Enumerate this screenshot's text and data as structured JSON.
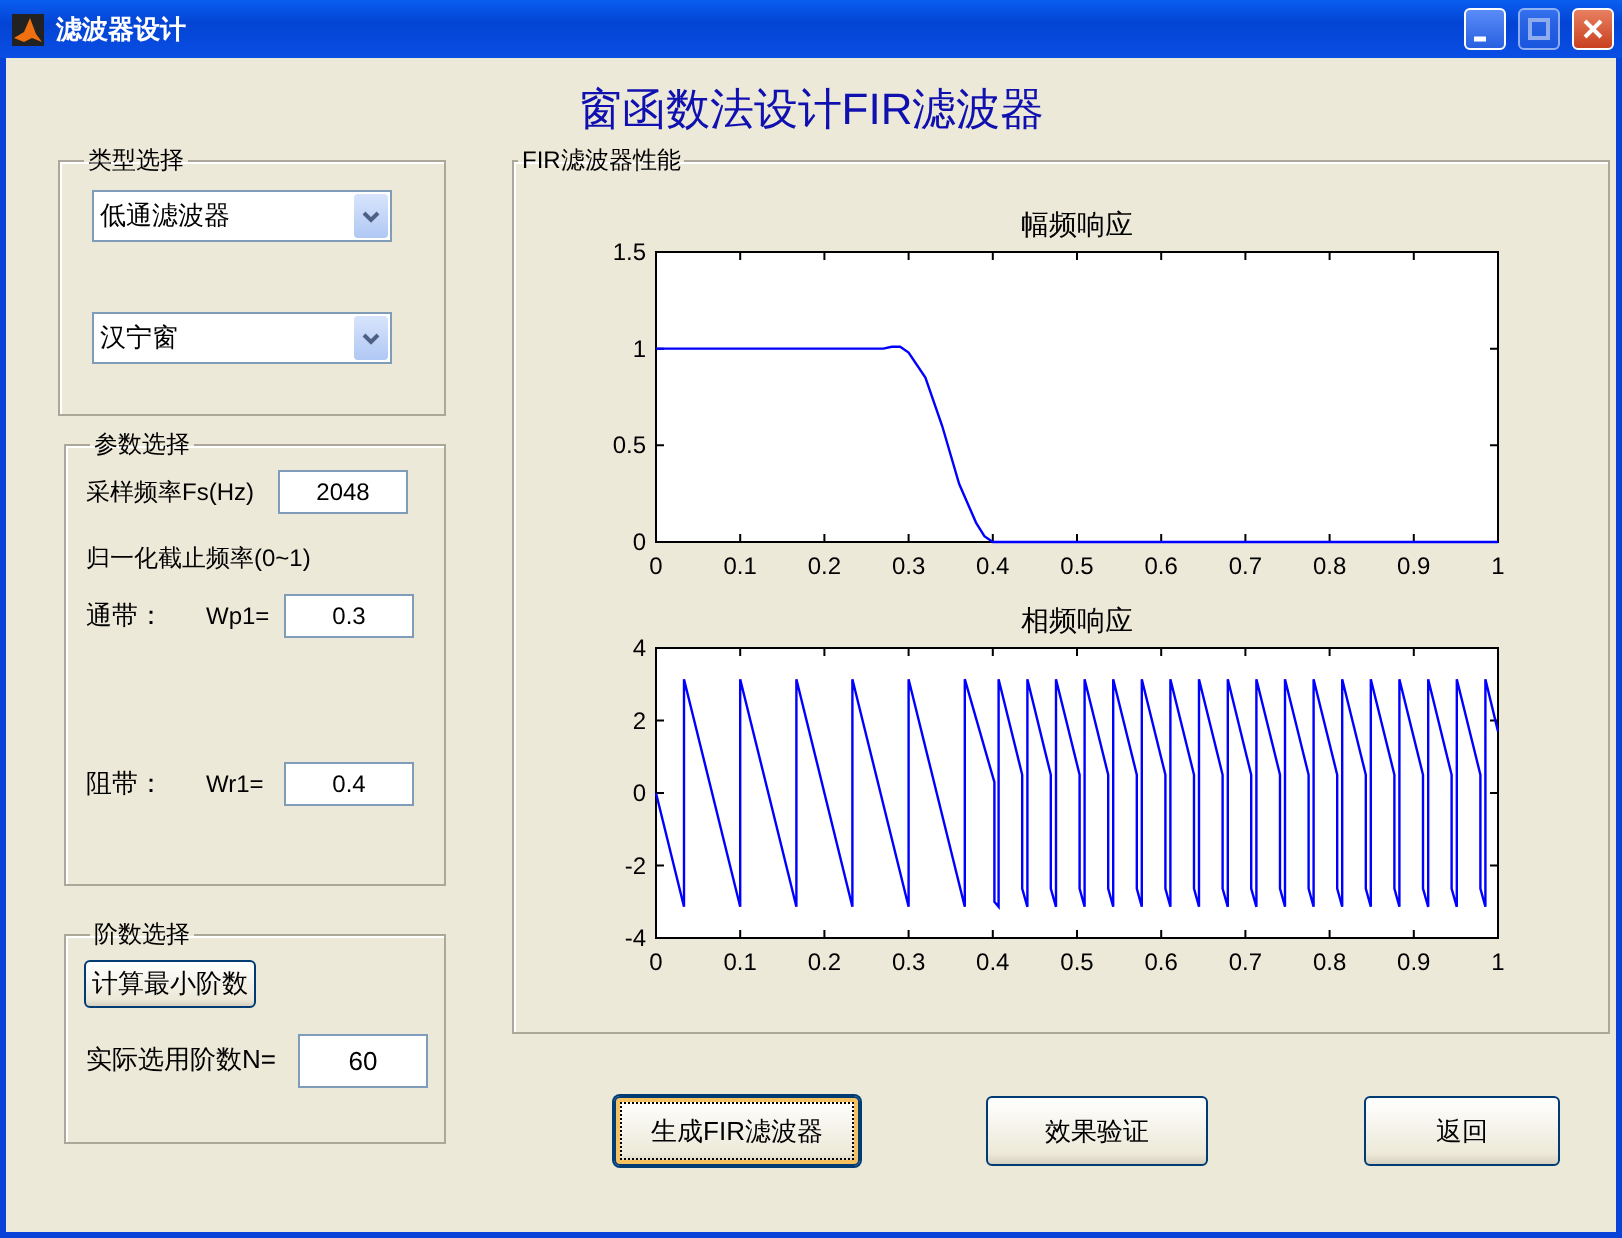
{
  "window": {
    "title": "滤波器设计",
    "controls": [
      {
        "kind": "minimize",
        "disabled": false
      },
      {
        "kind": "maximize",
        "disabled": true
      },
      {
        "kind": "close",
        "disabled": false
      }
    ]
  },
  "heading": "窗函数法设计FIR滤波器",
  "type_panel": {
    "legend": "类型选择",
    "dropdowns": [
      {
        "value": "低通滤波器"
      },
      {
        "value": "汉宁窗"
      }
    ]
  },
  "param_panel": {
    "legend": "参数选择",
    "fs_label": "采样频率Fs(Hz)",
    "fs_value": "2048",
    "cutoff_label": "归一化截止频率(0~1)",
    "bands": [
      {
        "band_label": "通带：",
        "name_label": "Wp1=",
        "value": "0.3"
      },
      {
        "band_label": "阻带：",
        "name_label": "Wr1=",
        "value": "0.4"
      }
    ]
  },
  "order_panel": {
    "legend": "阶数选择",
    "button": "计算最小阶数",
    "order_label": "实际选用阶数N=",
    "order_value": "60"
  },
  "performance_panel": {
    "legend": "FIR滤波器性能",
    "charts": [
      {
        "chart_data": {
          "type": "line",
          "title": "幅频响应",
          "xlim": [
            0,
            1
          ],
          "ylim": [
            0,
            1.5
          ],
          "xticks": [
            0,
            0.1,
            0.2,
            0.3,
            0.4,
            0.5,
            0.6,
            0.7,
            0.8,
            0.9,
            1
          ],
          "yticks": [
            0,
            0.5,
            1,
            1.5
          ],
          "x": [
            0,
            0.27,
            0.28,
            0.29,
            0.3,
            0.32,
            0.34,
            0.36,
            0.38,
            0.39,
            0.4,
            1
          ],
          "series": [
            {
              "color": "#0000ff",
              "values": [
                1,
                1,
                1.01,
                1.01,
                0.98,
                0.85,
                0.6,
                0.3,
                0.1,
                0.03,
                0,
                0
              ]
            }
          ]
        }
      },
      {
        "chart_data": {
          "type": "line",
          "title": "相频响应",
          "xlim": [
            0,
            1
          ],
          "ylim": [
            -4,
            4
          ],
          "xticks": [
            0,
            0.1,
            0.2,
            0.3,
            0.4,
            0.5,
            0.6,
            0.7,
            0.8,
            0.9,
            1
          ],
          "yticks": [
            -4,
            -2,
            0,
            2,
            4
          ],
          "x": [
            0,
            0.0333,
            0.0333,
            0.1,
            0.1,
            0.1667,
            0.1667,
            0.2333,
            0.2333,
            0.3,
            0.3,
            0.3667,
            0.3667,
            0.402,
            0.402,
            0.407,
            0.407,
            0.435,
            0.435,
            0.441,
            0.441,
            0.469,
            0.469,
            0.475,
            0.475,
            0.503,
            0.503,
            0.509,
            0.509,
            0.537,
            0.537,
            0.543,
            0.543,
            0.571,
            0.571,
            0.577,
            0.577,
            0.605,
            0.605,
            0.611,
            0.611,
            0.639,
            0.639,
            0.645,
            0.645,
            0.673,
            0.673,
            0.679,
            0.679,
            0.707,
            0.707,
            0.713,
            0.713,
            0.741,
            0.741,
            0.747,
            0.747,
            0.775,
            0.775,
            0.781,
            0.781,
            0.809,
            0.809,
            0.815,
            0.815,
            0.843,
            0.843,
            0.849,
            0.849,
            0.877,
            0.877,
            0.883,
            0.883,
            0.911,
            0.911,
            0.917,
            0.917,
            0.945,
            0.945,
            0.951,
            0.951,
            0.979,
            0.979,
            0.985,
            0.985,
            1
          ],
          "series": [
            {
              "color": "#0000ff",
              "values": [
                0,
                -3.14,
                3.14,
                -3.14,
                3.14,
                -3.14,
                3.14,
                -3.14,
                3.14,
                -3.14,
                3.14,
                -3.14,
                3.14,
                0.3,
                -3.0,
                -3.14,
                3.14,
                0.5,
                -2.64,
                -3.14,
                3.14,
                0.5,
                -2.64,
                -3.14,
                3.14,
                0.5,
                -2.64,
                -3.14,
                3.14,
                0.5,
                -2.64,
                -3.14,
                3.14,
                0.5,
                -2.64,
                -3.14,
                3.14,
                0.5,
                -2.64,
                -3.14,
                3.14,
                0.5,
                -2.64,
                -3.14,
                3.14,
                0.5,
                -2.64,
                -3.14,
                3.14,
                0.5,
                -2.64,
                -3.14,
                3.14,
                0.5,
                -2.64,
                -3.14,
                3.14,
                0.5,
                -2.64,
                -3.14,
                3.14,
                0.5,
                -2.64,
                -3.14,
                3.14,
                0.5,
                -2.64,
                -3.14,
                3.14,
                0.5,
                -2.64,
                -3.14,
                3.14,
                0.5,
                -2.64,
                -3.14,
                3.14,
                0.5,
                -2.64,
                -3.14,
                3.14,
                0.5,
                -2.64,
                -3.14,
                3.14,
                1.7
              ]
            }
          ]
        }
      }
    ]
  },
  "buttons": [
    {
      "label": "生成FIR滤波器",
      "focused": true
    },
    {
      "label": "效果验证",
      "focused": false
    },
    {
      "label": "返回",
      "focused": false
    }
  ]
}
